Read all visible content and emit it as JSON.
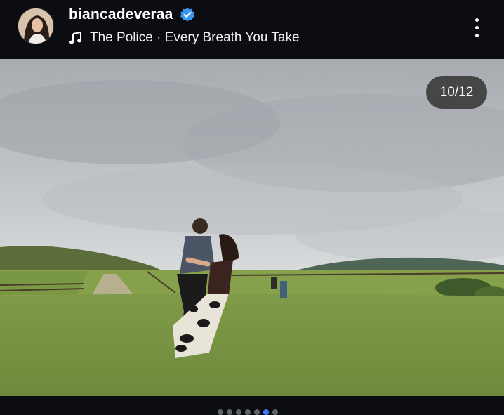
{
  "post": {
    "username": "biancadeveraa",
    "verified_icon": "verified-badge-icon",
    "music_icon": "music-note-icon",
    "music_text": "The Police · Every Breath You Take",
    "more_icon": "more-vertical-icon"
  },
  "carousel": {
    "counter": "10/12",
    "current_index": 10,
    "total": 12
  },
  "colors": {
    "background": "#0b0d12",
    "verified": "#3897f0",
    "active_dot": "#3d7bff",
    "inactive_dot": "#5f6368"
  }
}
